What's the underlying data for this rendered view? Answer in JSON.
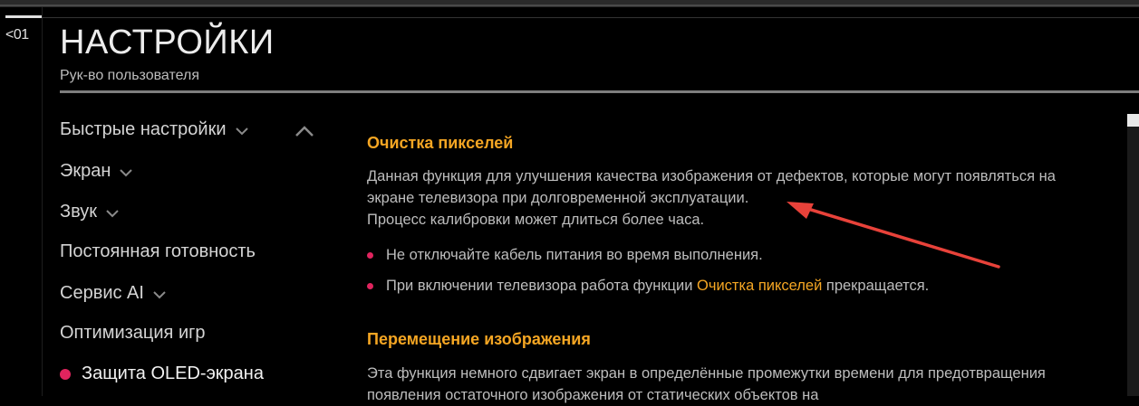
{
  "header": {
    "page_number": "<01",
    "title": "НАСТРОЙКИ",
    "subtitle": "Рук-во пользователя"
  },
  "sidebar": {
    "items": [
      {
        "label": "Быстрые настройки",
        "has_chevron": true
      },
      {
        "label": "Экран",
        "has_chevron": true
      },
      {
        "label": "Звук",
        "has_chevron": true
      },
      {
        "label": "Постоянная готовность",
        "has_chevron": false
      },
      {
        "label": "Сервис AI",
        "has_chevron": true
      },
      {
        "label": "Оптимизация игр",
        "has_chevron": false
      },
      {
        "label": "Защита OLED-экрана",
        "has_chevron": false,
        "active": true
      }
    ]
  },
  "content": {
    "section1": {
      "heading": "Очистка пикселей",
      "paragraph": "Данная функция для улучшения качества изображения от дефектов, которые могут появляться на экране телевизора при долговременной эксплуатации.",
      "paragraph2": "Процесс калибровки может длиться более часа.",
      "bullets": [
        {
          "text": "Не отключайте кабель питания во время выполнения."
        },
        {
          "prefix": "При включении телевизора работа функции ",
          "highlight": "Очистка пикселей",
          "suffix": " прекращается."
        }
      ]
    },
    "section2": {
      "heading": "Перемещение изображения",
      "paragraph": "Эта функция немного сдвигает экран в определённые промежутки времени для предотвращения появления остаточного изображения от статических объектов на"
    }
  },
  "colors": {
    "accent": "#f5a623",
    "bullet": "#e0245e",
    "arrow": "#e8423a",
    "background": "#000000"
  }
}
